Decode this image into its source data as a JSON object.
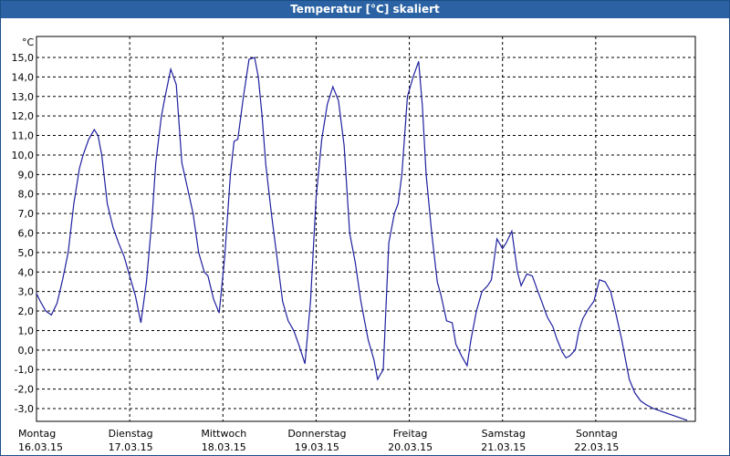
{
  "window": {
    "title": "Temperatur [°C] skaliert"
  },
  "colors": {
    "line": "#1f1f9f",
    "grid": "#000000",
    "title_bg": "#2a62a3"
  },
  "chart_data": {
    "type": "line",
    "title": "Temperatur [°C] skaliert",
    "ylabel": "°C",
    "ylim": [
      -3.0,
      15.0
    ],
    "ytick_step": 1.0,
    "yticks": [
      "15,0",
      "14,0",
      "13,0",
      "12,0",
      "11,0",
      "10,0",
      "9,0",
      "8,0",
      "7,0",
      "6,0",
      "5,0",
      "4,0",
      "3,0",
      "2,0",
      "1,0",
      "0,0",
      "-1,0",
      "-2,0",
      "-3,0"
    ],
    "xlim": [
      0,
      7
    ],
    "grid": "dashed",
    "days": [
      {
        "name": "Montag",
        "date": "16.03.15"
      },
      {
        "name": "Dienstag",
        "date": "17.03.15"
      },
      {
        "name": "Mittwoch",
        "date": "18.03.15"
      },
      {
        "name": "Donnerstag",
        "date": "19.03.15"
      },
      {
        "name": "Freitag",
        "date": "20.03.15"
      },
      {
        "name": "Samstag",
        "date": "21.03.15"
      },
      {
        "name": "Sonntag",
        "date": "22.03.15"
      }
    ],
    "series": [
      {
        "x": [
          0.0,
          0.04,
          0.1,
          0.16,
          0.22,
          0.28,
          0.34,
          0.4,
          0.46,
          0.5,
          0.56,
          0.62,
          0.66,
          0.7,
          0.76,
          0.82,
          0.88,
          0.94,
          1.0,
          1.06,
          1.12,
          1.18,
          1.24,
          1.28,
          1.34,
          1.38,
          1.44,
          1.5,
          1.56,
          1.62,
          1.68,
          1.74,
          1.8,
          1.84,
          1.9,
          1.96,
          2.02,
          2.08,
          2.12,
          2.16,
          2.22,
          2.28,
          2.34,
          2.38,
          2.42,
          2.46,
          2.52,
          2.56,
          2.6,
          2.64,
          2.7,
          2.76,
          2.82,
          2.88,
          2.94,
          3.0,
          3.06,
          3.12,
          3.18,
          3.24,
          3.3,
          3.36,
          3.42,
          3.48,
          3.52,
          3.56,
          3.62,
          3.66,
          3.72,
          3.78,
          3.84,
          3.88,
          3.92,
          3.98,
          4.04,
          4.1,
          4.14,
          4.18,
          4.24,
          4.3,
          4.34,
          4.4,
          4.46,
          4.5,
          4.56,
          4.62,
          4.66,
          4.72,
          4.78,
          4.84,
          4.88,
          4.94,
          5.0,
          5.04,
          5.1,
          5.16,
          5.2,
          5.26,
          5.32,
          5.38,
          5.42,
          5.48,
          5.54,
          5.58,
          5.64,
          5.68,
          5.72,
          5.78,
          5.82,
          5.86,
          5.92,
          5.98,
          6.04,
          6.1,
          6.16,
          6.22,
          6.28,
          6.32,
          6.36,
          6.42,
          6.48,
          6.54,
          6.58,
          6.62,
          6.68,
          6.74,
          6.8,
          6.86,
          6.92,
          6.98
        ],
        "values": [
          2.9,
          2.5,
          2.0,
          1.8,
          2.4,
          3.6,
          5.0,
          7.5,
          9.3,
          10.0,
          10.8,
          11.3,
          11.0,
          10.0,
          7.5,
          6.3,
          5.5,
          4.8,
          3.8,
          2.8,
          1.4,
          3.5,
          6.8,
          9.6,
          12.0,
          13.0,
          14.4,
          13.6,
          9.6,
          8.3,
          7.0,
          5.0,
          4.0,
          3.8,
          2.6,
          1.9,
          4.8,
          9.0,
          10.7,
          10.8,
          13.0,
          14.9,
          15.0,
          14.0,
          12.0,
          9.5,
          7.0,
          5.5,
          4.0,
          2.5,
          1.5,
          1.0,
          0.2,
          -0.7,
          2.5,
          7.8,
          10.8,
          12.6,
          13.5,
          12.8,
          10.5,
          6.0,
          4.5,
          2.5,
          1.5,
          0.5,
          -0.5,
          -1.5,
          -1.0,
          5.5,
          7.0,
          7.5,
          9.0,
          13.0,
          14.0,
          14.8,
          12.5,
          9.0,
          6.0,
          3.5,
          2.8,
          1.5,
          1.4,
          0.3,
          -0.3,
          -0.8,
          0.5,
          2.0,
          3.0,
          3.3,
          3.6,
          5.7,
          5.2,
          5.5,
          6.1,
          4.0,
          3.3,
          3.9,
          3.8,
          3.0,
          2.5,
          1.7,
          1.2,
          0.6,
          -0.1,
          -0.4,
          -0.3,
          0.0,
          1.0,
          1.6,
          2.1,
          2.5,
          3.6,
          3.5,
          3.0,
          1.8,
          0.5,
          -0.5,
          -1.5,
          -2.2,
          -2.6,
          -2.8,
          -2.9,
          -3.0,
          -3.1,
          -3.2,
          -3.3,
          -3.4,
          -3.5,
          -3.6
        ]
      }
    ]
  }
}
